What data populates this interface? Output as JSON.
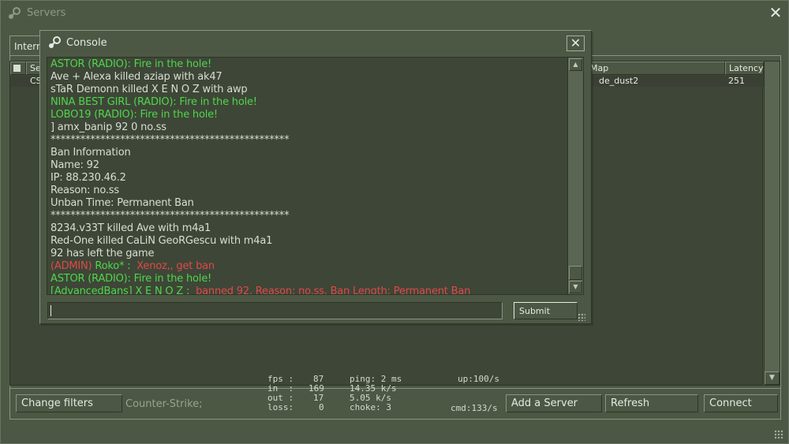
{
  "servers_window": {
    "title": "Servers",
    "close_glyph": "✕",
    "tab_label": "Internet",
    "columns": {
      "lock": "",
      "servers": "Servers",
      "map": "Map",
      "latency": "Latency"
    },
    "selected_row": {
      "name": "CS",
      "map": "de_dust2",
      "latency": "251"
    },
    "buttons": {
      "change_filters": "Change filters",
      "add_server": "Add a Server",
      "refresh": "Refresh",
      "connect": "Connect"
    },
    "filter_summary": "Counter-Strike;"
  },
  "netstats": {
    "fps_label": "fps :",
    "fps": "87",
    "in_label": "in  :",
    "in": "169",
    "out_label": "out :",
    "out": "17",
    "loss_label": "loss:",
    "loss": "0",
    "ping": "ping: 2 ms",
    "in_rate": "14.35 k/s",
    "out_rate": "5.05 k/s",
    "choke": "choke: 3",
    "up": "up:100/s",
    "cmd": "cmd:133/s"
  },
  "console": {
    "title": "Console",
    "close_glyph": "✕",
    "input_value": "",
    "submit_label": "Submit",
    "lines": [
      {
        "text": "ASTOR (RADIO): Fire in the hole!",
        "color": "green"
      },
      {
        "text": "Ave + Alexa killed aziap with ak47",
        "color": "white"
      },
      {
        "text": "sTaR Demonn killed X E N O Z with awp",
        "color": "white"
      },
      {
        "text": "NINA BEST GIRL (RADIO): Fire in the hole!",
        "color": "green"
      },
      {
        "text": "LOBO19 (RADIO): Fire in the hole!",
        "color": "green"
      },
      {
        "text": "] amx_banip 92 0 no.ss",
        "color": "white"
      },
      {
        "text": "************************************************",
        "color": "white"
      },
      {
        "text": "Ban Information",
        "color": "white"
      },
      {
        "text": "Name: 92",
        "color": "white"
      },
      {
        "text": "IP: 88.230.46.2",
        "color": "white"
      },
      {
        "text": "Reason: no.ss",
        "color": "white"
      },
      {
        "text": "Unban Time: Permanent Ban",
        "color": "white"
      },
      {
        "text": "************************************************",
        "color": "white"
      },
      {
        "text": "8234.v33T killed Ave with m4a1",
        "color": "white"
      },
      {
        "text": "Red-One killed CaLiN GeoRGescu with m4a1",
        "color": "white"
      },
      {
        "text": "92 has left the game",
        "color": "white"
      }
    ],
    "admin_line": {
      "tag": "(ADMIN)",
      "name": "Roko* :",
      "message": "Xenoz,, get ban"
    },
    "radio_line": {
      "text": "ASTOR (RADIO): Fire in the hole!"
    },
    "ban_line": {
      "tag": "[AdvancedBans] X E N O Z :",
      "message": "banned 92. Reason: no.ss. Ban Length: Permanent Ban"
    }
  },
  "colors": {
    "panel": "#4c5844",
    "chat_green": "#4fd64b",
    "admin_red": "#e0484a",
    "text": "#d8ded3"
  },
  "icons": {
    "app": "steam-logo-icon",
    "close": "close-icon",
    "scroll_up": "scroll-up-arrow-icon",
    "scroll_down": "scroll-down-arrow-icon",
    "resize": "resize-grip-icon",
    "lock": "lock-icon"
  }
}
